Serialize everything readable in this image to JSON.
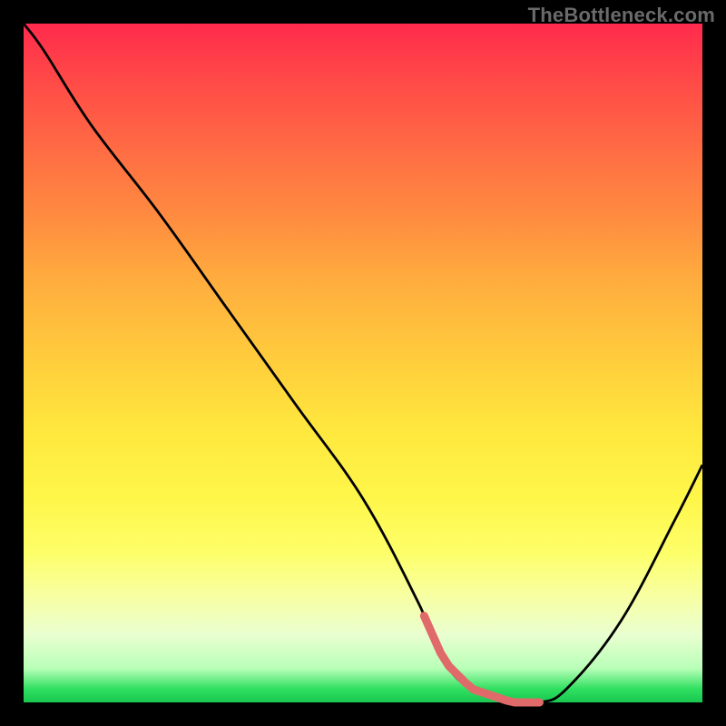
{
  "watermark": "TheBottleneck.com",
  "chart_data": {
    "type": "line",
    "title": "",
    "xlabel": "",
    "ylabel": "",
    "ylim": [
      0,
      100
    ],
    "xlim": [
      0,
      100
    ],
    "x": [
      0,
      3,
      10,
      20,
      30,
      40,
      50,
      58,
      62,
      66,
      72,
      76,
      80,
      88,
      96,
      100
    ],
    "values": [
      100,
      96,
      85,
      72,
      58,
      44,
      30,
      15,
      6,
      2,
      0,
      0,
      2,
      12,
      27,
      35
    ],
    "marker_segment_x": [
      59,
      76
    ],
    "curve_color": "#000000",
    "marker_color": "#e06a6a"
  }
}
